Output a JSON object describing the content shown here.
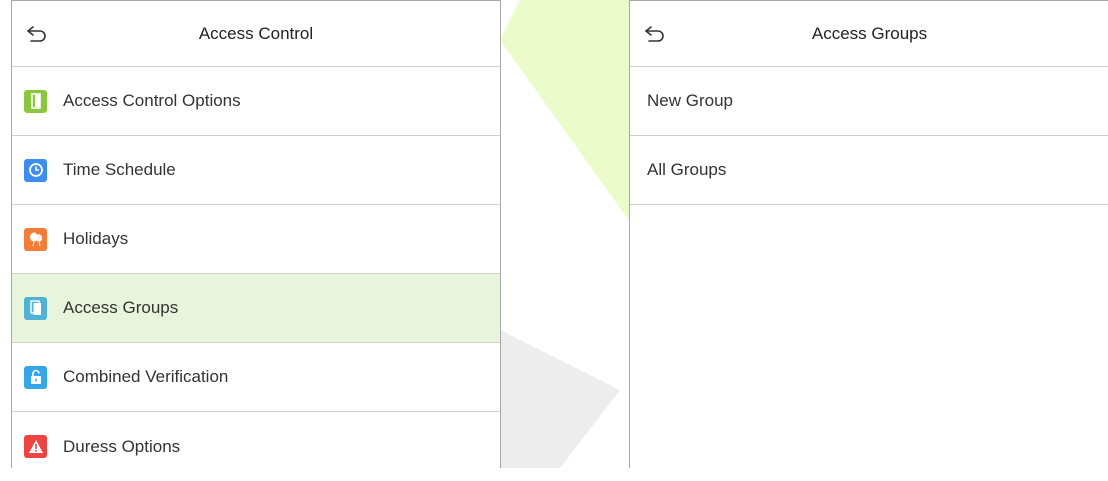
{
  "colors": {
    "selected_row_bg": "#e9f4dd",
    "watermark_green": "#d9f56a",
    "watermark_gray": "#ededed"
  },
  "left_panel": {
    "title": "Access Control",
    "back_icon": "back-arrow-icon",
    "selected_index": 3,
    "items": [
      {
        "label": "Access Control Options",
        "icon": "door-icon",
        "color": "#8cc63f"
      },
      {
        "label": "Time Schedule",
        "icon": "clock-icon",
        "color": "#3d8ef0"
      },
      {
        "label": "Holidays",
        "icon": "balloons-icon",
        "color": "#f27c38"
      },
      {
        "label": "Access Groups",
        "icon": "group-door-icon",
        "color": "#4fb3d6"
      },
      {
        "label": "Combined Verification",
        "icon": "unlock-icon",
        "color": "#35a6e8"
      },
      {
        "label": "Duress Options",
        "icon": "warning-icon",
        "color": "#ee4343"
      }
    ]
  },
  "right_panel": {
    "title": "Access Groups",
    "back_icon": "back-arrow-icon",
    "items": [
      {
        "label": "New Group"
      },
      {
        "label": "All Groups"
      }
    ]
  }
}
